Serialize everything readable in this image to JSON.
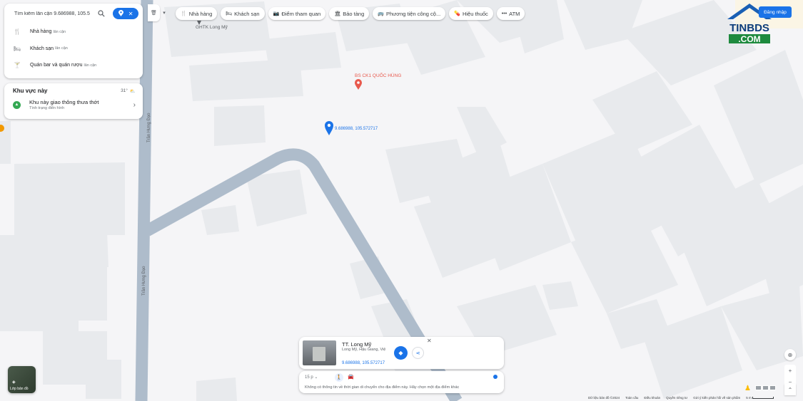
{
  "search": {
    "value": "Tìm kiếm lân cận 9.686988, 105.5",
    "suggestions": [
      {
        "icon": "restaurant-icon",
        "label": "Nhà hàng",
        "sub": "lân cận"
      },
      {
        "icon": "hotel-icon",
        "label": "Khách sạn",
        "sub": "lân cận"
      },
      {
        "icon": "bar-icon",
        "label": "Quán bar và quán rượu",
        "sub": "lân cận"
      }
    ]
  },
  "area": {
    "title": "Khu vực này",
    "temperature": "31°",
    "traffic_title": "Khu này giao thông thưa thớt",
    "traffic_sub": "Tình trạng điển hình"
  },
  "chips": [
    {
      "icon": "restaurant-icon",
      "label": "Nhà hàng"
    },
    {
      "icon": "hotel-icon",
      "label": "Khách sạn"
    },
    {
      "icon": "camera-icon",
      "label": "Điểm tham quan"
    },
    {
      "icon": "museum-icon",
      "label": "Bảo tàng"
    },
    {
      "icon": "transit-icon",
      "label": "Phương tiện công cộ..."
    },
    {
      "icon": "pharmacy-icon",
      "label": "Hiệu thuốc"
    },
    {
      "icon": "more-icon",
      "label": "ATM"
    }
  ],
  "login_label": "Đăng nhập",
  "watermark": {
    "line1": "TINBDS",
    "line2": ".COM"
  },
  "map": {
    "business_label": "GHTK Long Mỹ",
    "poi_label": "BS CK1 QUỐC HÙNG",
    "pin_coords": "9.686988, 105.572717",
    "street_name": "Trần Hưng Đạo"
  },
  "place": {
    "title": "TT. Long Mỹ",
    "address": "Long Mỹ, Hậu Giang, Việ",
    "coords": "9.686988, 105.572717"
  },
  "travel": {
    "mode": "15 p",
    "message": "Không có thông tin về thời gian di chuyển cho địa điểm này. Hãy chọn một địa điểm khác"
  },
  "layers_label": "Lớp bản đồ",
  "footer": {
    "copyright": "Dữ liệu bản đồ ©2024",
    "links": [
      "Toàn cầu",
      "Điều khoản",
      "Quyền riêng tư",
      "Gửi ý kiến phản hồi về sản phẩm"
    ],
    "scale": "5 m"
  },
  "colors": {
    "accent": "#1a73e8",
    "map_bg": "#f5f5f7",
    "building": "#e8eaed",
    "road": "#aebccb",
    "poi": "#e8594d",
    "traffic_green": "#34a853"
  }
}
